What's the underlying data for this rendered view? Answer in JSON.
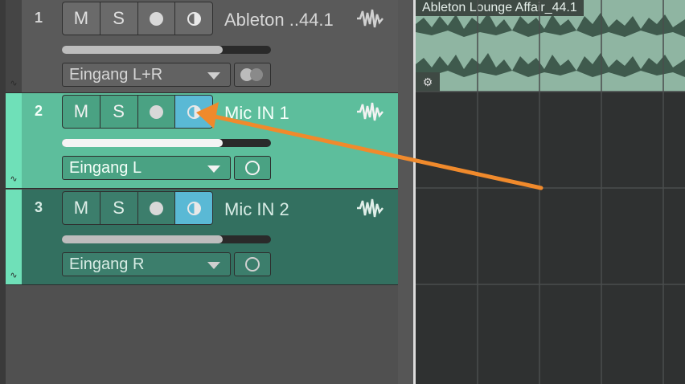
{
  "colors": {
    "track_selected": "#5dbe9c",
    "track_armed": "#337060",
    "monitor_active": "#5ab9d5",
    "annotation_arrow": "#f08a2c"
  },
  "tracks": [
    {
      "number": "1",
      "mute": "M",
      "solo": "S",
      "name": "Ableton ..44.1",
      "input": "Eingang L+R",
      "volume_fraction": 0.77,
      "monitor_on": false
    },
    {
      "number": "2",
      "mute": "M",
      "solo": "S",
      "name": "Mic IN 1",
      "input": "Eingang L",
      "volume_fraction": 0.77,
      "monitor_on": true
    },
    {
      "number": "3",
      "mute": "M",
      "solo": "S",
      "name": "Mic IN 2",
      "input": "Eingang R",
      "volume_fraction": 0.77,
      "monitor_on": true
    }
  ],
  "clip": {
    "title": "Ableton Lounge Affair_44.1",
    "gear": "⚙"
  },
  "icons": {
    "automation": "automation-icon",
    "waveform": "waveform-icon",
    "record": "record-icon",
    "monitor": "monitor-icon"
  }
}
